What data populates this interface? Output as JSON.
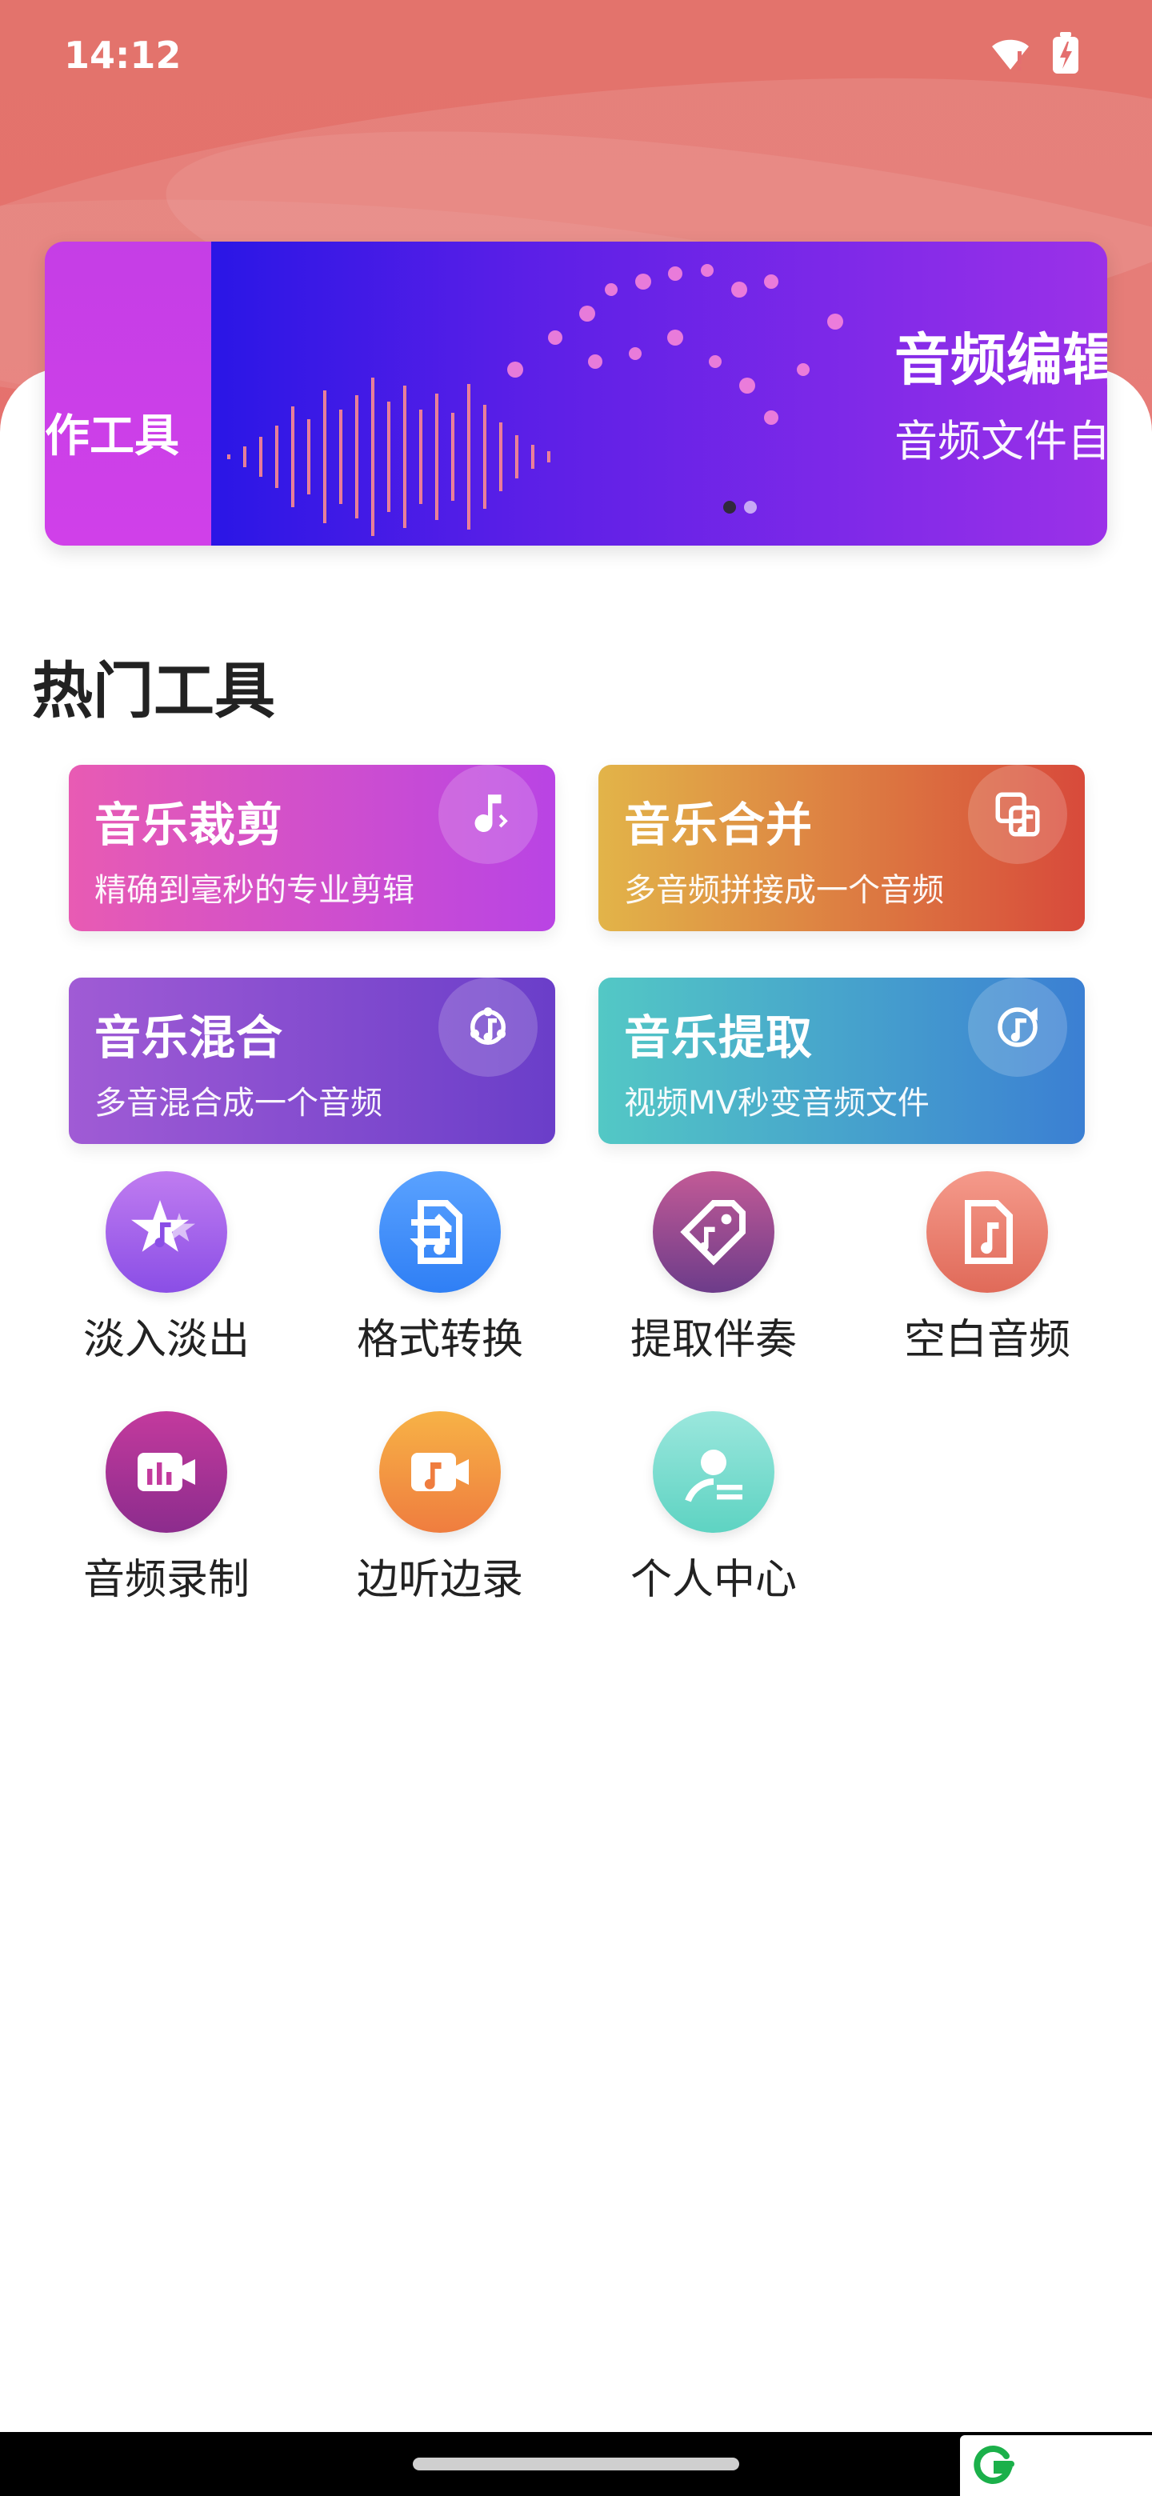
{
  "status": {
    "time": "14:12"
  },
  "banner": {
    "left_text": "作工具",
    "title": "音频编辑器",
    "subtitle": "音频文件自由",
    "dots": 2
  },
  "section": {
    "title": "热门工具"
  },
  "cards": [
    {
      "title": "音乐裁剪",
      "subtitle": "精确到毫秒的专业剪辑",
      "icon": "music-note-cut-icon",
      "colors": [
        "#e85bb3",
        "#b944e4"
      ]
    },
    {
      "title": "音乐合并",
      "subtitle": "多音频拼接成一个音频",
      "icon": "merge-icon",
      "colors": [
        "#e2b449",
        "#d84a3b"
      ]
    },
    {
      "title": "音乐混合",
      "subtitle": "多音混合成一个音频",
      "icon": "mix-icon",
      "colors": [
        "#a05bd5",
        "#6a3ec9"
      ]
    },
    {
      "title": "音乐提取",
      "subtitle": "视频MV秒变音频文件",
      "icon": "extract-icon",
      "colors": [
        "#53c8c5",
        "#3b7fd3"
      ]
    }
  ],
  "tools": [
    {
      "label": "淡入淡出",
      "icon": "star-music-icon",
      "colors": [
        "#c07cf0",
        "#8a4ee6"
      ]
    },
    {
      "label": "格式转换",
      "icon": "format-convert-icon",
      "colors": [
        "#5aa2ff",
        "#2f7ff5"
      ]
    },
    {
      "label": "提取伴奏",
      "icon": "tag-music-icon",
      "colors": [
        "#c25a96",
        "#6d3c8a"
      ]
    },
    {
      "label": "空白音频",
      "icon": "blank-audio-icon",
      "colors": [
        "#f59a8b",
        "#e06a59"
      ]
    },
    {
      "label": "音频录制",
      "icon": "audio-record-icon",
      "colors": [
        "#c33a9d",
        "#8c2c8d"
      ]
    },
    {
      "label": "边听边录",
      "icon": "listen-record-icon",
      "colors": [
        "#f7b246",
        "#ef7d3f"
      ]
    },
    {
      "label": "个人中心",
      "icon": "user-center-icon",
      "colors": [
        "#9be7dd",
        "#5ed3c2"
      ]
    }
  ]
}
